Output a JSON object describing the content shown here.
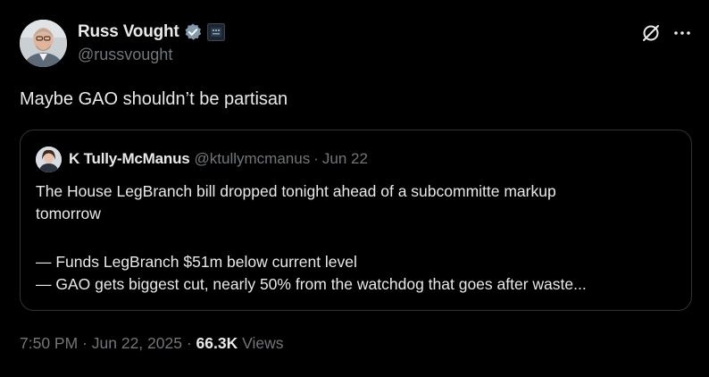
{
  "author": {
    "display_name": "Russ Vought",
    "handle": "@russvought",
    "verified_icon": "verified-badge-icon",
    "affiliation_icon": "government-affiliation-icon"
  },
  "tweet": {
    "text": "Maybe GAO shouldn’t be partisan"
  },
  "quoted_tweet": {
    "display_name": "K Tully-McManus",
    "handle": "@ktullymcmanus",
    "separator": "·",
    "date": "Jun 22",
    "lines": [
      "The House LegBranch bill dropped tonight ahead of a subcommitte markup",
      "tomorrow",
      "— Funds LegBranch $51m below current level",
      "— GAO gets biggest cut, nearly 50% from the watchdog that goes after waste..."
    ]
  },
  "meta": {
    "time": "7:50 PM",
    "separator": "·",
    "date": "Jun 22, 2025",
    "views_count": "66.3K",
    "views_label": "Views"
  },
  "colors": {
    "background": "#000000",
    "primary_text": "#e7e9ea",
    "secondary_text": "#71767b",
    "border": "#2f3336",
    "verified_blue": "#1d9bf0"
  }
}
